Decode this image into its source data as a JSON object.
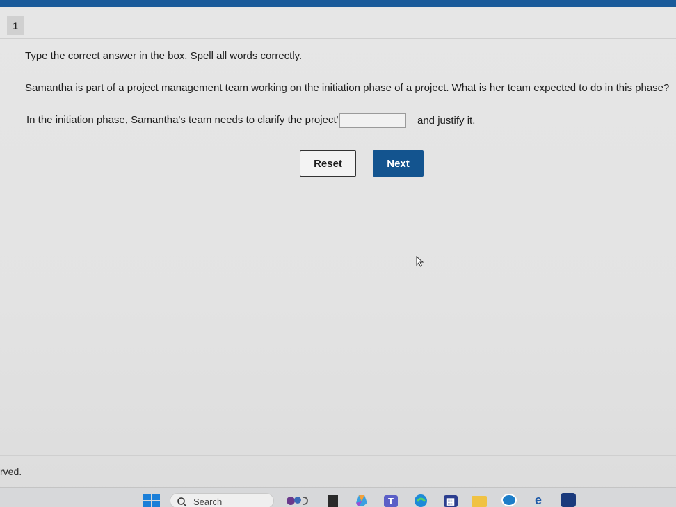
{
  "question": {
    "number": "1",
    "instruction": "Type the correct answer in the box. Spell all words correctly.",
    "prompt": "Samantha is part of a project management team working on the initiation phase of a project. What is her team expected to do in this phase?",
    "sentence_before": "In the initiation phase, Samantha's team needs to clarify the project's",
    "sentence_after": "and justify it.",
    "answer_value": ""
  },
  "buttons": {
    "reset_label": "Reset",
    "next_label": "Next"
  },
  "footer": {
    "text": "rved."
  },
  "taskbar": {
    "search_label": "Search",
    "icons": [
      "windows-start-icon",
      "search-icon",
      "widgets-icon",
      "task-view-icon",
      "copilot-icon",
      "teams-icon",
      "edge-icon",
      "store-icon",
      "file-explorer-icon",
      "dell-icon",
      "ie-icon",
      "app-icon"
    ]
  },
  "colors": {
    "accent": "#13548f",
    "top_bar": "#1a5a9a"
  }
}
